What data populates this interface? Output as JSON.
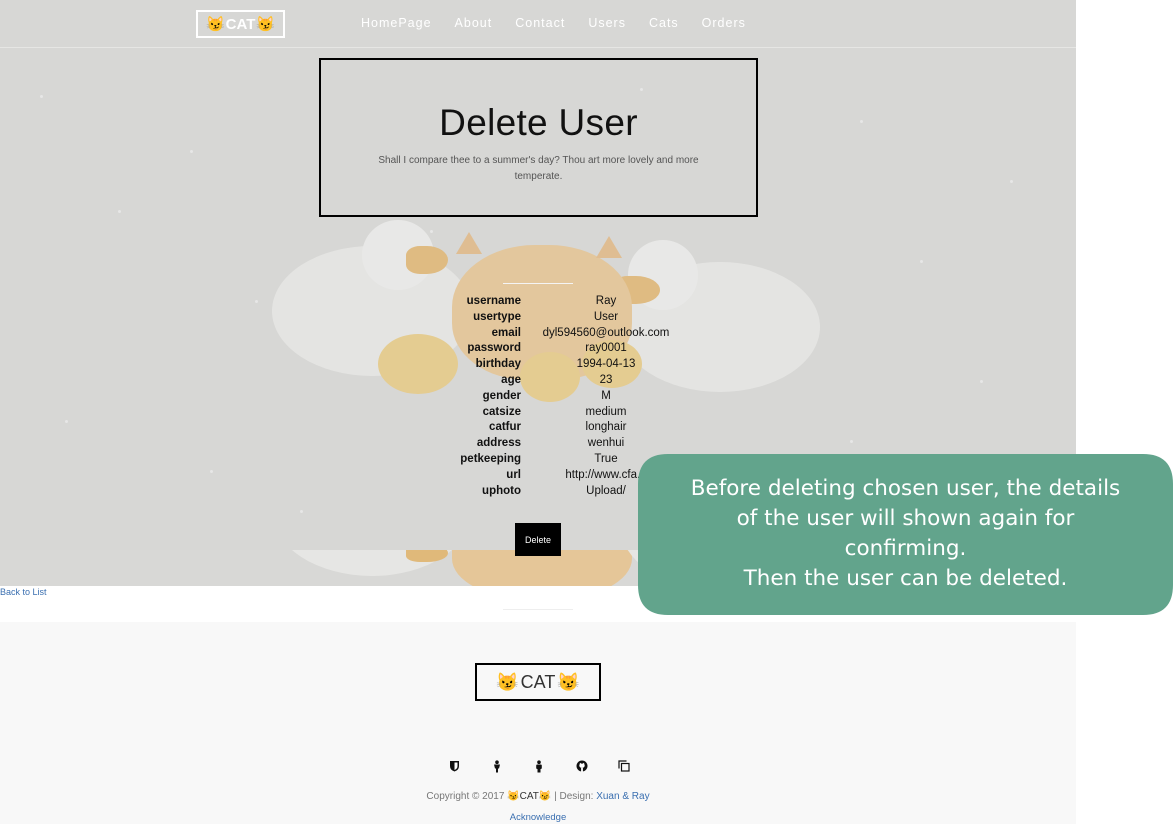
{
  "nav": {
    "logo_text": "CAT",
    "logo_icon": "cat-face-emoji",
    "items": [
      "HomePage",
      "About",
      "Contact",
      "Users",
      "Cats",
      "Orders"
    ]
  },
  "header": {
    "title": "Delete User",
    "subtitle": "Shall I compare thee to a summer's day? Thou art more lovely and more temperate."
  },
  "details": [
    {
      "label": "username",
      "value": "Ray"
    },
    {
      "label": "usertype",
      "value": "User"
    },
    {
      "label": "email",
      "value": "dyl594560@outlook.com"
    },
    {
      "label": "password",
      "value": "ray0001"
    },
    {
      "label": "birthday",
      "value": "1994-04-13"
    },
    {
      "label": "age",
      "value": "23"
    },
    {
      "label": "gender",
      "value": "M"
    },
    {
      "label": "catsize",
      "value": "medium"
    },
    {
      "label": "catfur",
      "value": "longhair"
    },
    {
      "label": "address",
      "value": "wenhui"
    },
    {
      "label": "petkeeping",
      "value": "True"
    },
    {
      "label": "url",
      "value": "http://www.cfa.o"
    },
    {
      "label": "uphoto",
      "value": "Upload/"
    }
  ],
  "actions": {
    "delete_label": "Delete",
    "back_link": "Back to List"
  },
  "footer": {
    "logo_text": "CAT",
    "social_icons": [
      "shield-icon",
      "person-icon",
      "person-alt-icon",
      "github-icon",
      "copy-icon"
    ],
    "copyright_prefix": "Copyright © 2017",
    "copyright_brand": "CAT",
    "design_label": "| Design:",
    "design_link": "Xuan & Ray",
    "acknowledge": "Acknowledge"
  },
  "annotation": {
    "text": "Before deleting chosen user, the details\nof the user will shown again for\nconfirming.\nThen the user can be deleted.",
    "color": "#62a48c"
  }
}
